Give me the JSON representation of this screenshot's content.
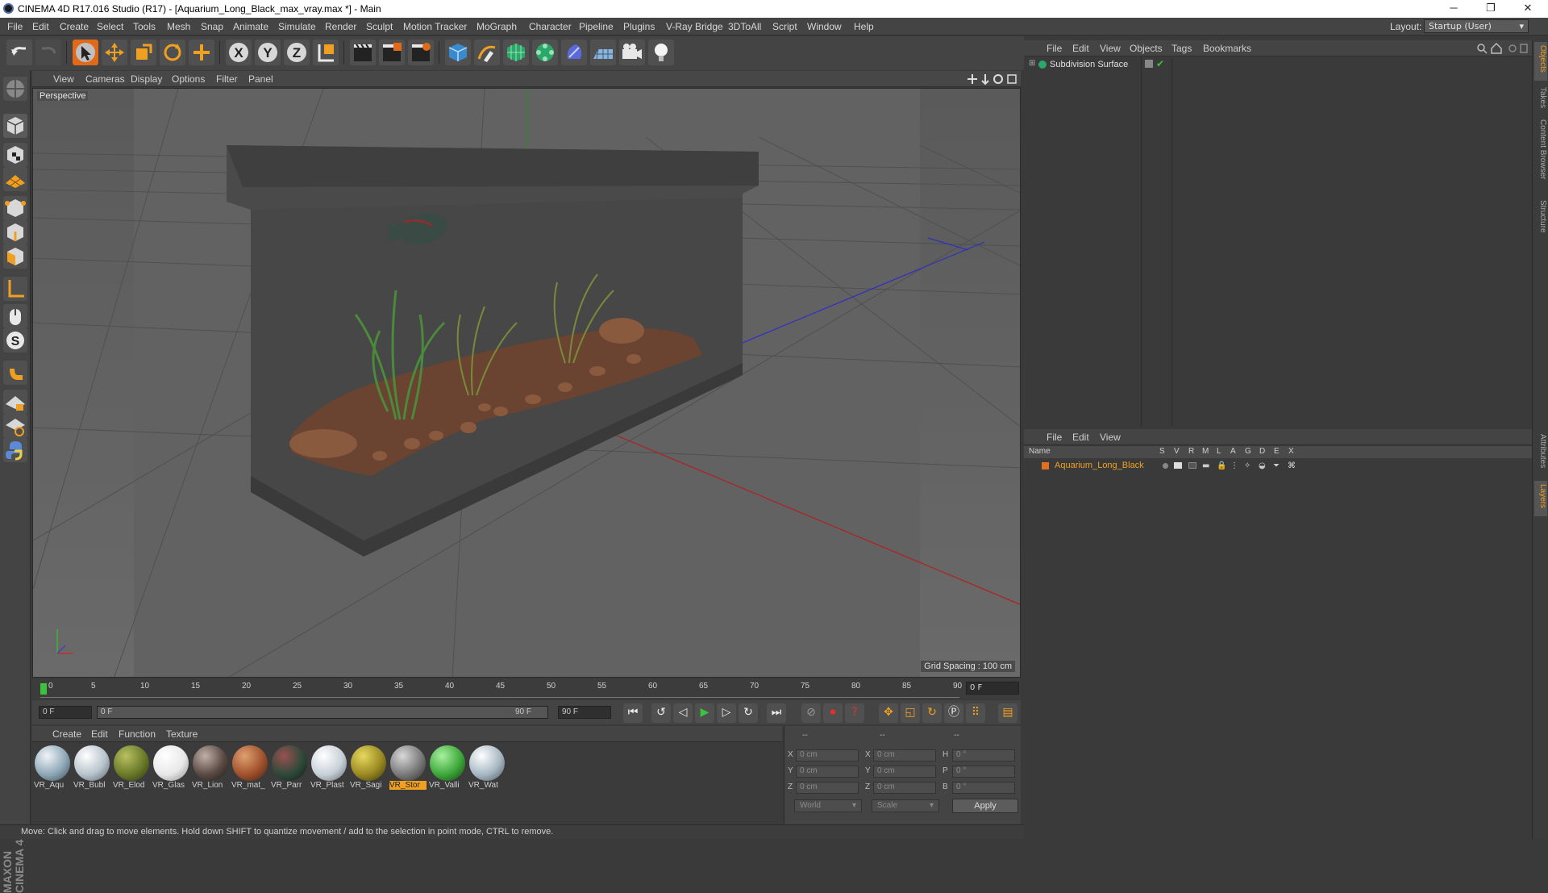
{
  "window": {
    "title": "CINEMA 4D R17.016 Studio (R17) - [Aquarium_Long_Black_max_vray.max *] - Main",
    "minimize": "─",
    "maximize": "❐",
    "close": "✕"
  },
  "menubar": {
    "items": [
      "File",
      "Edit",
      "Create",
      "Select",
      "Tools",
      "Mesh",
      "Snap",
      "Animate",
      "Simulate",
      "Render",
      "Sculpt",
      "Motion Tracker",
      "MoGraph",
      "Character",
      "Pipeline",
      "Plugins",
      "V-Ray Bridge",
      "3DToAll",
      "Script",
      "Window",
      "Help"
    ],
    "layout_label": "Layout:",
    "layout_value": "Startup (User)"
  },
  "toolbar": {
    "icons": [
      "undo-icon",
      "redo-icon",
      "select-arrow-icon",
      "move-icon",
      "scale-icon",
      "rotate-icon",
      "recent-tool-icon",
      "axis-x-icon",
      "axis-y-icon",
      "axis-z-icon",
      "world-coord-icon",
      "render-view-icon",
      "render-picture-viewer-icon",
      "edit-render-settings-icon",
      "cube-icon",
      "pen-spline-icon",
      "subdivision-icon",
      "array-icon",
      "deformer-icon",
      "floor-icon",
      "camera-icon",
      "light-icon"
    ]
  },
  "viewport": {
    "menu": [
      "View",
      "Cameras",
      "Display",
      "Options",
      "Filter",
      "Panel"
    ],
    "label": "Perspective",
    "grid_spacing": "Grid Spacing : 100 cm"
  },
  "timeline": {
    "ticks": [
      "0",
      "5",
      "10",
      "15",
      "20",
      "25",
      "30",
      "35",
      "40",
      "45",
      "50",
      "55",
      "60",
      "65",
      "70",
      "75",
      "80",
      "85",
      "90"
    ],
    "current_frame": "0 F",
    "start_field": "0 F",
    "range_start": "0 F",
    "range_end": "90 F",
    "end_field": "90 F"
  },
  "material_manager": {
    "menu": [
      "Create",
      "Edit",
      "Function",
      "Texture"
    ],
    "materials": [
      {
        "label": "VR_Aqu",
        "color": "#8fa8b8",
        "selected": false
      },
      {
        "label": "VR_Bubl",
        "color": "#b8c4cc",
        "selected": false
      },
      {
        "label": "VR_Elod",
        "color": "#6b7a2a",
        "selected": false
      },
      {
        "label": "VR_Glas",
        "color": "#e8e8e8",
        "selected": false
      },
      {
        "label": "VR_Lion",
        "color": "#5a4a44",
        "selected": false
      },
      {
        "label": "VR_mat_",
        "color": "#a0522d",
        "selected": false
      },
      {
        "label": "VR_Parr",
        "color": "#2e4a3a",
        "selected": false
      },
      {
        "label": "VR_Plast",
        "color": "#c8d0d8",
        "selected": false
      },
      {
        "label": "VR_Sagi",
        "color": "#9a8a22",
        "selected": false
      },
      {
        "label": "VR_Stor",
        "color": "#7a7a7a",
        "selected": true
      },
      {
        "label": "VR_Valli",
        "color": "#3ea83a",
        "selected": false
      },
      {
        "label": "VR_Wat",
        "color": "#a8b8c4",
        "selected": false
      }
    ]
  },
  "coordinates": {
    "header": [
      "--",
      "--",
      "--"
    ],
    "rows": [
      {
        "a": "X",
        "av": "0 cm",
        "b": "X",
        "bv": "0 cm",
        "c": "H",
        "cv": "0 °"
      },
      {
        "a": "Y",
        "av": "0 cm",
        "b": "Y",
        "bv": "0 cm",
        "c": "P",
        "cv": "0 °"
      },
      {
        "a": "Z",
        "av": "0 cm",
        "b": "Z",
        "bv": "0 cm",
        "c": "B",
        "cv": "0 °"
      }
    ],
    "mode1": "World",
    "mode2": "Scale",
    "apply": "Apply"
  },
  "object_manager": {
    "menu": [
      "File",
      "Edit",
      "View",
      "Objects",
      "Tags",
      "Bookmarks"
    ],
    "object_name": "Subdivision Surface"
  },
  "layer_manager": {
    "menu": [
      "File",
      "Edit",
      "View"
    ],
    "columns": [
      "Name",
      "S",
      "V",
      "R",
      "M",
      "L",
      "A",
      "G",
      "D",
      "E",
      "X"
    ],
    "layer_name": "Aquarium_Long_Black",
    "layer_color": "#e07020"
  },
  "right_tabs": [
    "Objects",
    "Takes",
    "Content Browser",
    "Structure",
    "Attributes",
    "Layers"
  ],
  "status": "Move: Click and drag to move elements. Hold down SHIFT to quantize movement / add to the selection in point mode, CTRL to remove.",
  "logo": "MAXON CINEMA 4D"
}
